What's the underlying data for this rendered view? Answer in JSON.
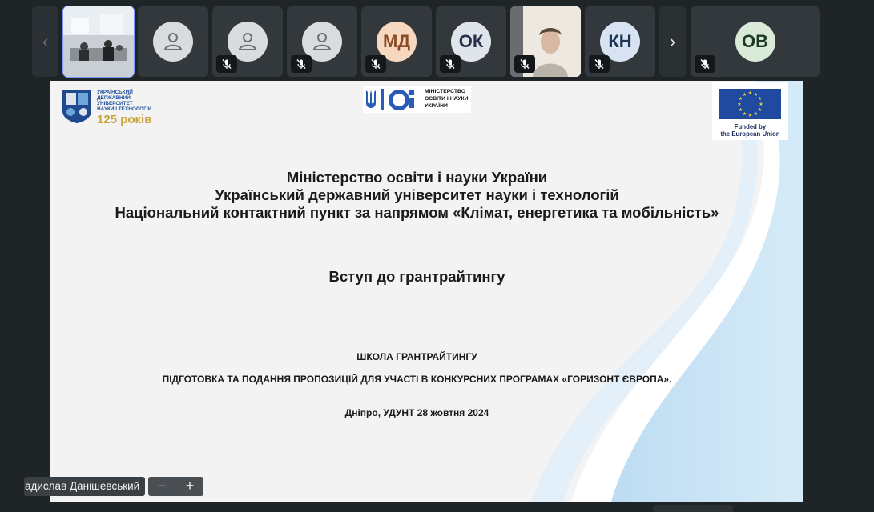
{
  "participants": [
    {
      "kind": "video-room",
      "muted": false,
      "active": true
    },
    {
      "kind": "placeholder",
      "muted": false
    },
    {
      "kind": "placeholder",
      "muted": true
    },
    {
      "kind": "placeholder",
      "muted": true
    },
    {
      "kind": "initials",
      "initials": "МД",
      "bg": "#f6d8c0",
      "fg": "#8a4a23",
      "muted": true
    },
    {
      "kind": "initials",
      "initials": "ОК",
      "bg": "#e0e4eb",
      "fg": "#27324a",
      "muted": true
    },
    {
      "kind": "video-person",
      "muted": true
    },
    {
      "kind": "initials",
      "initials": "КН",
      "bg": "#d7e2f2",
      "fg": "#1d3553",
      "muted": true
    },
    {
      "kind": "initials",
      "initials": "ОВ",
      "bg": "#d9ead9",
      "fg": "#1d3a24",
      "muted": true
    }
  ],
  "slide": {
    "university_logo": {
      "lines": [
        "УКРАЇНСЬКИЙ",
        "ДЕРЖАВНИЙ",
        "УНІВЕРСИТЕТ",
        "НАУКИ І ТЕХНОЛОГІЙ"
      ],
      "years": "125 років"
    },
    "ministry_logo": {
      "lines": [
        "МІНІСТЕРСТВО",
        "ОСВІТИ І НАУКИ",
        "УКРАЇНИ"
      ]
    },
    "eu_logo": {
      "lines": [
        "Funded by",
        "the European Union"
      ]
    },
    "title_lines": [
      "Міністерство освіти і науки України",
      "Український державний університет науки і технологій",
      "Національний контактний пункт за напрямом «Клімат, енергетика та мобільність»"
    ],
    "subtitle": "Вступ до грантрайтингу",
    "school": "ШКОЛА ГРАНТРАЙТИНГУ",
    "preparation": "ПІДГОТОВКА ТА ПОДАННЯ ПРОПОЗИЦІЙ ДЛЯ УЧАСТІ В КОНКУРСНИХ ПРОГРАМАХ «ГОРИЗОНТ ЄВРОПА».",
    "place_date": "Дніпро, УДУНТ 28 жовтня 2024"
  },
  "presenter_name": "адислав Данішевський",
  "zoom": {
    "minus": "−",
    "plus": "+"
  },
  "colors": {
    "accent": "#7f96ff",
    "background": "#1f2427",
    "tile": "#33383c"
  }
}
